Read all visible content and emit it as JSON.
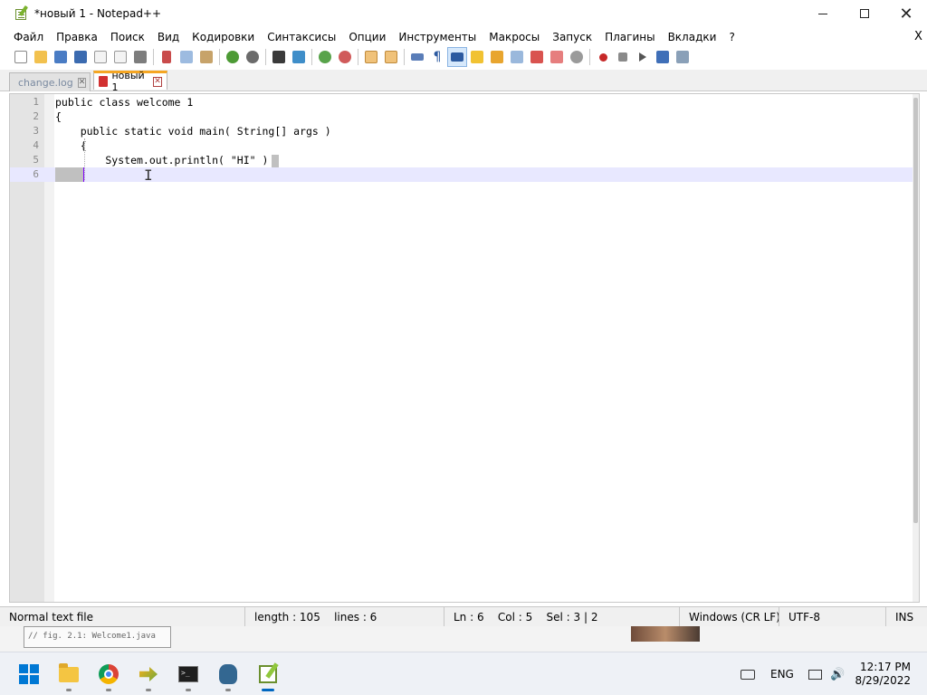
{
  "window": {
    "title": "*новый 1 - Notepad++",
    "controls": {
      "minimize": "",
      "maximize": "",
      "close": "✕"
    }
  },
  "menu": {
    "items": [
      "Файл",
      "Правка",
      "Поиск",
      "Вид",
      "Кодировки",
      "Синтаксисы",
      "Опции",
      "Инструменты",
      "Макросы",
      "Запуск",
      "Плагины",
      "Вкладки",
      "?"
    ],
    "close_glyph": "X"
  },
  "toolbar": {
    "buttons": [
      "new-file",
      "open-file",
      "save",
      "save-all",
      "close",
      "close-all",
      "print",
      "cut",
      "copy",
      "paste",
      "undo",
      "redo",
      "find",
      "replace",
      "zoom-in",
      "zoom-out",
      "sync-v",
      "sync-h",
      "word-wrap",
      "show-all-chars",
      "indent-guide",
      "udl",
      "doc-map",
      "function-list",
      "folder-as-workspace",
      "monitor",
      "record-macro",
      "stop-macro",
      "play-macro",
      "run-macro-multiple",
      "save-macro"
    ]
  },
  "tabs": [
    {
      "label": "change.log",
      "active": false,
      "close": "✕"
    },
    {
      "label": "новый 1",
      "active": true,
      "close": "✕"
    }
  ],
  "editor": {
    "lines": [
      {
        "num": "1",
        "code": "public class welcome 1"
      },
      {
        "num": "2",
        "code": "{"
      },
      {
        "num": "3",
        "code": "    public static void main( String[] args )"
      },
      {
        "num": "4",
        "code": "    {"
      },
      {
        "num": "5",
        "code": "        System.out.println( \"HI\" )"
      },
      {
        "num": "6",
        "code": ""
      }
    ],
    "cursor_glyph": "I"
  },
  "status": {
    "file_type": "Normal text file",
    "length": "length : 105",
    "lines": "lines : 6",
    "ln": "Ln : 6",
    "col": "Col : 5",
    "sel": "Sel : 3 | 2",
    "eol": "Windows (CR LF)",
    "encoding": "UTF-8",
    "mode": "INS"
  },
  "background": {
    "code_snippet": "// fig. 2.1: Welcome1.java"
  },
  "taskbar": {
    "apps": [
      "start",
      "file-explorer",
      "chrome",
      "app-arrow",
      "command-prompt",
      "postgresql",
      "notepad-plus-plus"
    ],
    "language": "ENG",
    "time": "12:17 PM",
    "date": "8/29/2022"
  }
}
